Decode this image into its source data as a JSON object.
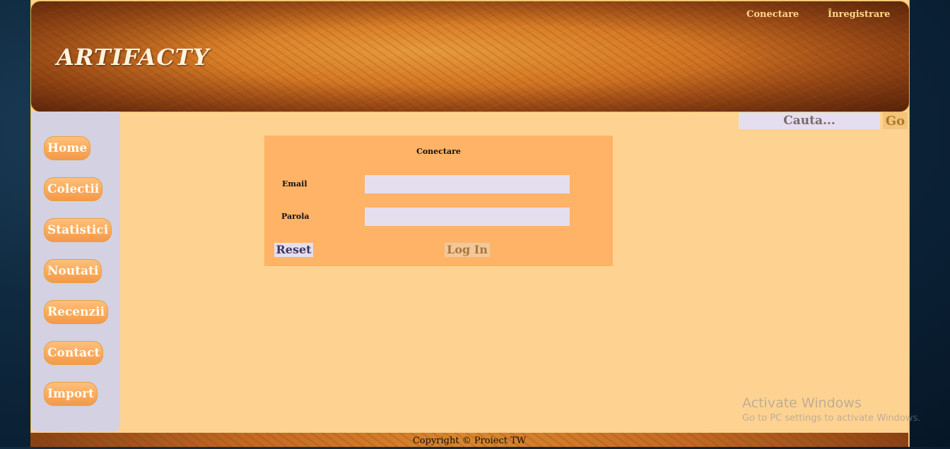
{
  "header": {
    "logo": "ARTIFACTY",
    "links": {
      "login": "Conectare",
      "register": "Înregistrare"
    }
  },
  "search": {
    "placeholder": "Cauta...",
    "go_label": "Go"
  },
  "sidebar": {
    "items": [
      {
        "label": "Home"
      },
      {
        "label": "Colectii"
      },
      {
        "label": "Statistici"
      },
      {
        "label": "Noutati"
      },
      {
        "label": "Recenzii"
      },
      {
        "label": "Contact"
      },
      {
        "label": "Import"
      }
    ]
  },
  "login_form": {
    "title": "Conectare",
    "email_label": "Email",
    "password_label": "Parola",
    "email_value": "",
    "password_value": "",
    "reset_label": "Reset",
    "submit_label": "Log In"
  },
  "footer": {
    "copyright": "Copyright © Proiect TW"
  },
  "watermark": {
    "title": "Activate Windows",
    "subtitle": "Go to PC settings to activate Windows."
  },
  "colors": {
    "page_background": "#fed392",
    "sidebar": "#d3d1e2",
    "panel": "#ffb366",
    "nav_button": "#f9a85a",
    "input": "#e4deef"
  }
}
